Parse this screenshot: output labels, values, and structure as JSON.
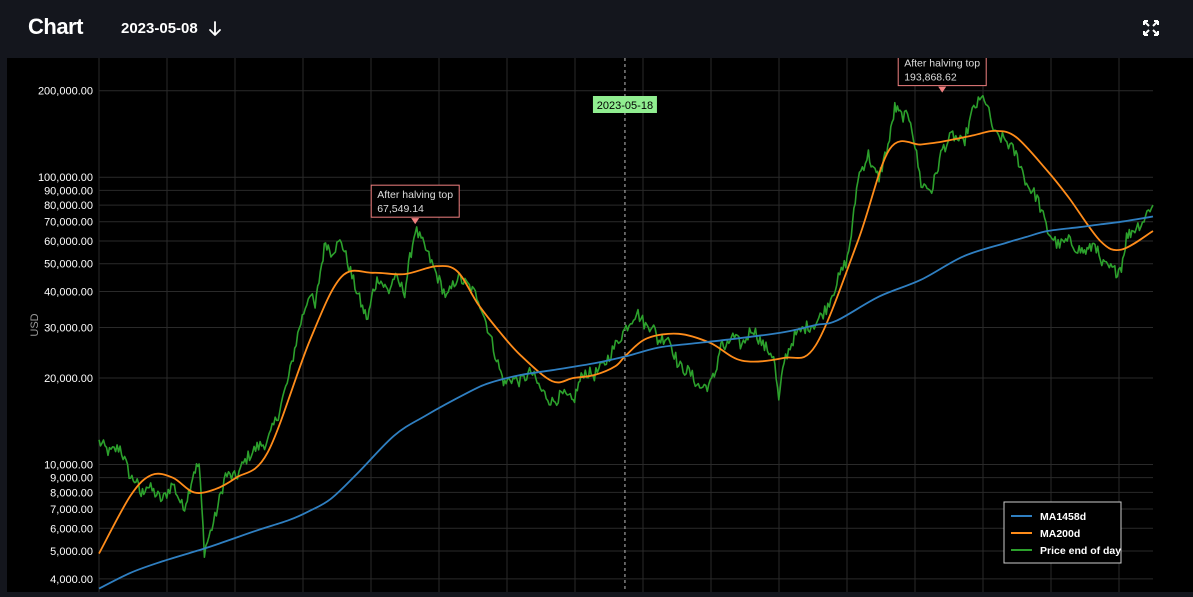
{
  "header": {
    "title": "Chart",
    "date": "2023-05-08"
  },
  "colors": {
    "background": "#000000",
    "header_bg": "#14161d",
    "grid": "#2a2a2a",
    "ma1458": "#2f7fc1",
    "ma200": "#ff8c1a",
    "price": "#2ca02c",
    "annotation_border": "#f08080",
    "marker_bg": "#90ee90"
  },
  "chart_data": {
    "type": "line",
    "ylabel": "USD",
    "yscale": "log",
    "ylim": [
      3600,
      260000
    ],
    "y_ticks": [
      "4,000.00",
      "5,000.00",
      "6,000.00",
      "7,000.00",
      "8,000.00",
      "9,000.00",
      "10,000.00",
      "20,000.00",
      "30,000.00",
      "40,000.00",
      "50,000.00",
      "60,000.00",
      "70,000.00",
      "80,000.00",
      "90,000.00",
      "100,000.00",
      "200,000.00"
    ],
    "y_tick_values": [
      4000,
      5000,
      6000,
      7000,
      8000,
      9000,
      10000,
      20000,
      30000,
      40000,
      50000,
      60000,
      70000,
      80000,
      90000,
      100000,
      200000
    ],
    "x_label_shown": "2023-05-18",
    "x_label_pos": 0.499,
    "legend": {
      "placement": "bottom-right"
    },
    "annotations": [
      {
        "title": "After halving top",
        "value": "67,549.14",
        "t": 0.3,
        "y": 67549.14
      },
      {
        "title": "After halving top",
        "value": "193,868.62",
        "t": 0.8,
        "y": 193868.62
      }
    ],
    "series": [
      {
        "name": "MA1458d",
        "t": [
          0,
          0.03,
          0.06,
          0.1,
          0.12,
          0.15,
          0.18,
          0.2,
          0.22,
          0.245,
          0.28,
          0.31,
          0.35,
          0.37,
          0.4,
          0.43,
          0.47,
          0.5,
          0.53,
          0.56,
          0.6,
          0.65,
          0.68,
          0.7,
          0.74,
          0.78,
          0.82,
          0.86,
          0.88,
          0.9,
          0.93,
          0.95,
          0.97,
          1.0
        ],
        "values": [
          3700,
          4200,
          4600,
          5100,
          5400,
          5900,
          6400,
          6900,
          7600,
          9300,
          12600,
          14800,
          17800,
          19200,
          20500,
          21300,
          22500,
          23800,
          25500,
          26300,
          27300,
          28900,
          30600,
          31700,
          38400,
          44000,
          53000,
          59000,
          62000,
          65000,
          67000,
          68500,
          70000,
          73000
        ]
      },
      {
        "name": "MA200d",
        "t": [
          0,
          0.03,
          0.05,
          0.07,
          0.09,
          0.11,
          0.13,
          0.16,
          0.2,
          0.23,
          0.26,
          0.29,
          0.32,
          0.34,
          0.36,
          0.38,
          0.4,
          0.43,
          0.45,
          0.47,
          0.49,
          0.5,
          0.52,
          0.55,
          0.58,
          0.61,
          0.65,
          0.68,
          0.72,
          0.75,
          0.78,
          0.8,
          0.83,
          0.85,
          0.87,
          0.9,
          0.92,
          0.95,
          0.97,
          1.0
        ],
        "values": [
          4900,
          7800,
          9200,
          9000,
          8000,
          8200,
          9000,
          11000,
          27000,
          45000,
          46500,
          46000,
          49000,
          47000,
          36000,
          29000,
          24000,
          19500,
          20000,
          20500,
          22000,
          24000,
          27500,
          28500,
          26500,
          23000,
          23500,
          26000,
          60000,
          125000,
          130000,
          133000,
          140000,
          145000,
          138000,
          105000,
          85000,
          60000,
          56000,
          65000
        ]
      },
      {
        "name": "Price end of day",
        "t": [
          0,
          0.01,
          0.02,
          0.03,
          0.035,
          0.04,
          0.045,
          0.06,
          0.07,
          0.08,
          0.085,
          0.09,
          0.095,
          0.1,
          0.11,
          0.12,
          0.13,
          0.14,
          0.15,
          0.16,
          0.17,
          0.18,
          0.19,
          0.2,
          0.205,
          0.21,
          0.215,
          0.22,
          0.23,
          0.24,
          0.25,
          0.255,
          0.26,
          0.265,
          0.27,
          0.275,
          0.28,
          0.29,
          0.295,
          0.3,
          0.31,
          0.32,
          0.33,
          0.34,
          0.35,
          0.36,
          0.37,
          0.38,
          0.385,
          0.39,
          0.4,
          0.41,
          0.42,
          0.43,
          0.44,
          0.45,
          0.455,
          0.46,
          0.47,
          0.48,
          0.49,
          0.5,
          0.51,
          0.52,
          0.525,
          0.53,
          0.54,
          0.55,
          0.56,
          0.57,
          0.58,
          0.585,
          0.59,
          0.595,
          0.6,
          0.61,
          0.62,
          0.63,
          0.64,
          0.645,
          0.65,
          0.66,
          0.67,
          0.68,
          0.69,
          0.7,
          0.71,
          0.715,
          0.72,
          0.73,
          0.735,
          0.74,
          0.75,
          0.755,
          0.76,
          0.77,
          0.78,
          0.79,
          0.795,
          0.8,
          0.81,
          0.82,
          0.83,
          0.84,
          0.85,
          0.86,
          0.87,
          0.875,
          0.88,
          0.89,
          0.9,
          0.91,
          0.92,
          0.93,
          0.935,
          0.94,
          0.945,
          0.95,
          0.96,
          0.965,
          0.97,
          0.975,
          0.98,
          0.99,
          1.0
        ],
        "values": [
          12000,
          11000,
          11500,
          9000,
          8800,
          7800,
          8500,
          7500,
          8600,
          7000,
          8000,
          9500,
          10000,
          5000,
          6500,
          9200,
          9000,
          10500,
          11500,
          12000,
          15000,
          20000,
          30000,
          40000,
          35000,
          47000,
          60000,
          55000,
          60000,
          45000,
          35000,
          32000,
          40000,
          45000,
          42000,
          40000,
          45000,
          40000,
          52000,
          66000,
          56000,
          46000,
          38000,
          45000,
          42000,
          38000,
          29000,
          21500,
          19000,
          20000,
          19500,
          21000,
          18000,
          16500,
          17500,
          16500,
          19000,
          21000,
          20500,
          22500,
          26000,
          30000,
          34000,
          30000,
          31000,
          27000,
          28000,
          22000,
          21000,
          18500,
          19000,
          21000,
          26500,
          25000,
          28000,
          26000,
          30000,
          26000,
          24000,
          16500,
          23000,
          28000,
          30000,
          31000,
          35000,
          43000,
          52000,
          68000,
          100000,
          120000,
          105000,
          100000,
          135000,
          175000,
          165000,
          160000,
          95000,
          90000,
          105000,
          125000,
          140000,
          130000,
          175000,
          190000,
          140000,
          135000,
          120000,
          108000,
          95000,
          85000,
          65000,
          58000,
          60000,
          56000,
          55000,
          56000,
          60000,
          50000,
          48000,
          47000,
          49000,
          62000,
          65000,
          70000,
          82000,
          80000
        ]
      }
    ]
  }
}
